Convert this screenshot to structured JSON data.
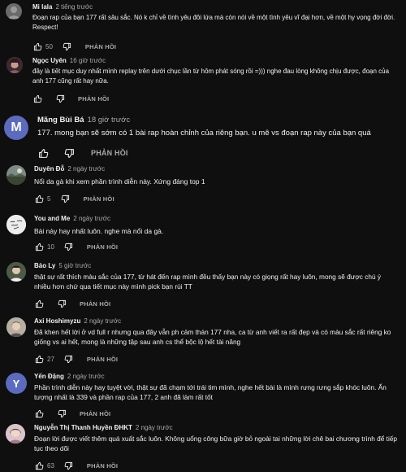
{
  "icons": {
    "like": "thumb-up-icon",
    "dislike": "thumb-down-icon"
  },
  "reply_label": "PHẢN HỒI",
  "comments": [
    {
      "author": "Mi lala",
      "time": "2 tiếng trước",
      "text": "Đoạn rap của bạn 177 rất sâu sắc. Nó k chỉ về tình yêu đôi lứa mà còn nói về một tình yêu vĩ đại hơn, về một hy vọng đời đời. Respect!",
      "likes": "50",
      "avatar_color": "#6a6a6a"
    },
    {
      "author": "Ngọc Uyên",
      "time": "16 giờ trước",
      "text": "đây là tiết mục duy nhất mình replay trên dưới chục lần từ hôm phát sóng rồi =))) nghe đau lòng không chịu được, đoạn của anh 177 cũng rất hay nữa.",
      "likes": "",
      "avatar_color": "#8a5a64"
    },
    {
      "author": "Mãng Bùi Bá",
      "time": "18 giờ trước",
      "text": "177. mong bạn sẽ sớm có 1 bài rap hoàn chỉnh của riêng bạn. u mê vs đoạn rap này của bạn quá",
      "likes": "",
      "avatar_letter": "M",
      "avatar_color": "#5c6bc0"
    },
    {
      "author": "Duyên Đỗ",
      "time": "2 ngày trước",
      "text": "Nổi da gà khi xem phần trình diễn này. Xứng đáng top 1",
      "likes": "5",
      "avatar_color": "#5d6d5a"
    },
    {
      "author": "You and Me",
      "time": "2 ngày trước",
      "text": "Bài này hay nhất luôn. nghe mà nổi da gà.",
      "likes": "10",
      "avatar_color": "#ededed"
    },
    {
      "author": "Bảo Ly",
      "time": "5 giờ trước",
      "text": "thật sự rất thích màu sắc của 177, từ hát đến rap mình đều thấy bạn này có giọng rất hay luôn, mong sẽ được chú ý nhiều hơn chứ qua tiết mục này mình pick bạn rùi TT",
      "likes": "",
      "avatar_color": "#4e5a48"
    },
    {
      "author": "Axi Hoshimyzu",
      "time": "2 ngày trước",
      "text": "Đã khen hết lời ở vd full r nhưng qua đây vẫn ph cảm thán 177 nha, ca từ anh viết ra rất đẹp và có màu sắc rất riêng ko giống vs ai hết, mong là những tập sau anh cs thể bộc lộ hết tài năng",
      "likes": "27",
      "avatar_color": "#8a7d72"
    },
    {
      "author": "Yến Đặng",
      "time": "2 ngày trước",
      "text": "Phần trình diễn này hay tuyệt vời, thật sự đã chạm tới trái tim mình, nghe hết bài là mình rưng rưng sắp khóc luôn. Ấn tượng nhất là 339 và phần rap của 177, 2 anh đã làm rất tốt",
      "likes": "",
      "avatar_letter": "Y",
      "avatar_color": "#5c6bc0"
    },
    {
      "author": "Nguyễn Thị Thanh Huyền ĐHKT",
      "time": "2 ngày trước",
      "text": "Đoạn lời được viết thêm quá xuất sắc luôn. Không uổng công bữa giờ bỏ ngoài tai những lời chê bai chương trình để tiếp tục theo dõi",
      "likes": "63",
      "avatar_color": "#b59aa4"
    }
  ]
}
